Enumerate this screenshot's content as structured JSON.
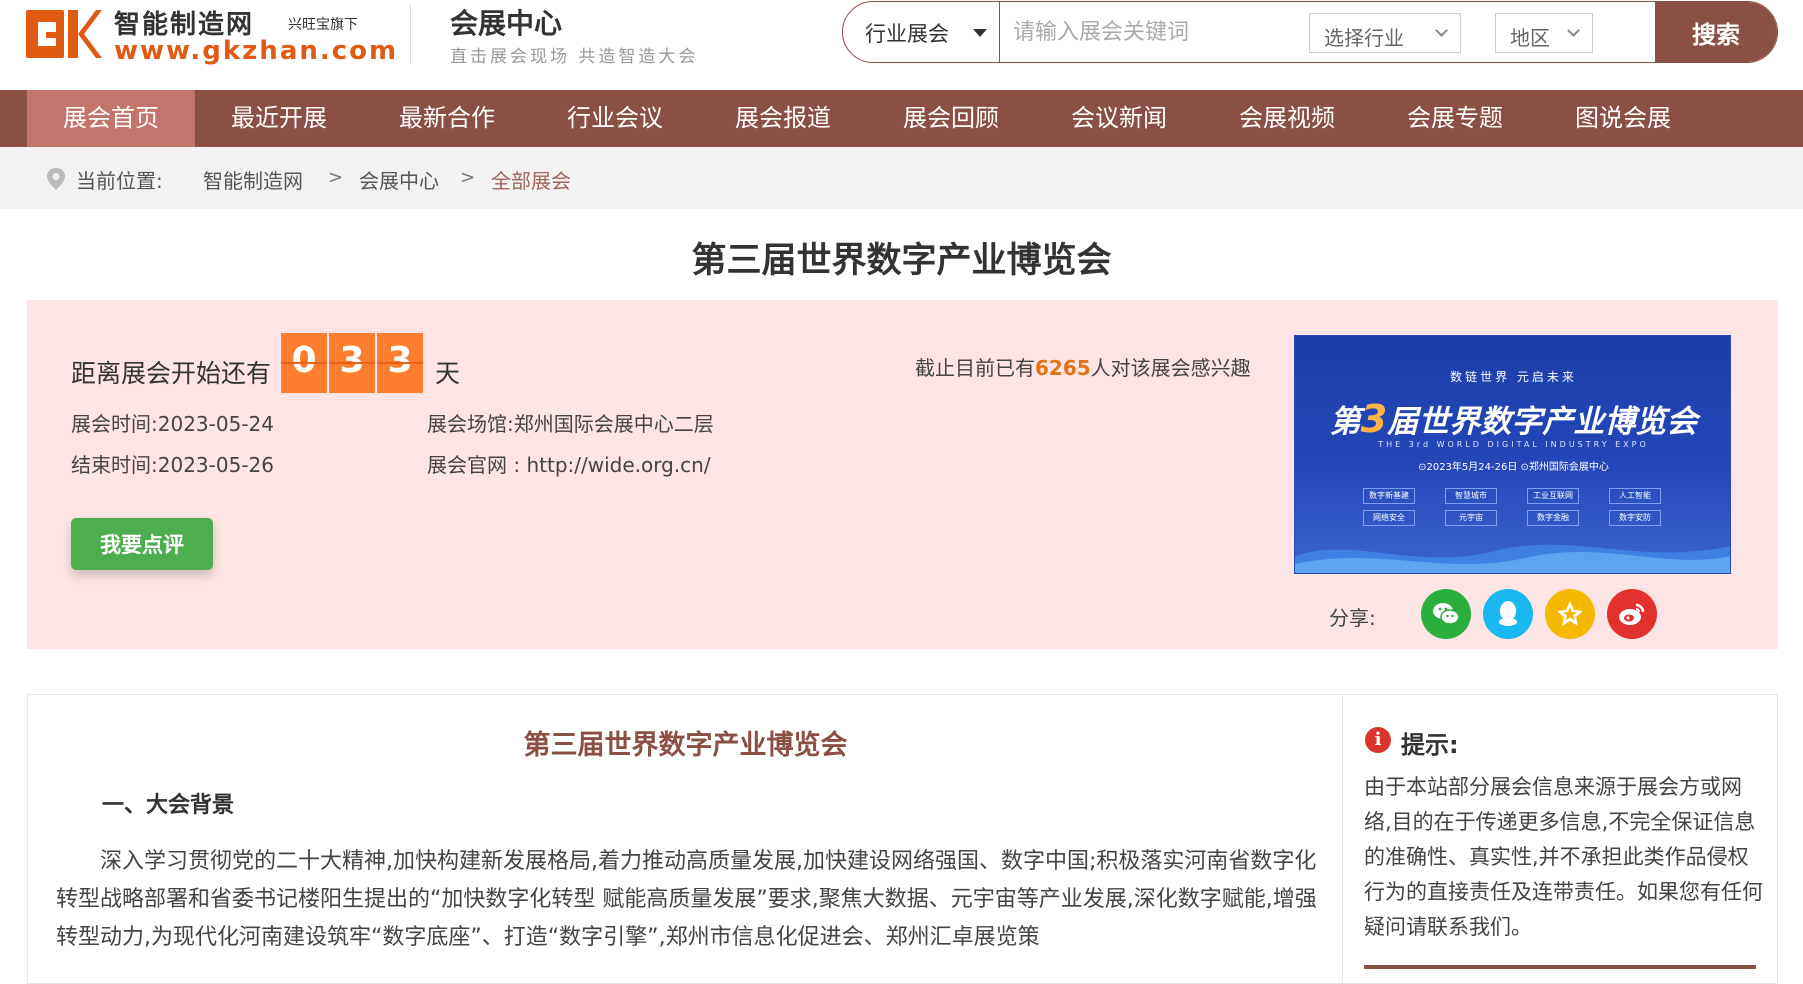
{
  "header": {
    "logo_title": "智能制造网",
    "logo_tag": "兴旺宝旗下",
    "logo_url": "www.gkzhan.com",
    "site_title": "会展中心",
    "site_slogan": "直击展会现场 共造智造大会",
    "brand_color": "#e05a12",
    "accent_color": "#8c4f45"
  },
  "search": {
    "type_label": "行业展会",
    "placeholder": "请输入展会关键词",
    "industry_select": "选择行业",
    "region_select": "地区",
    "button": "搜索"
  },
  "nav": {
    "items": [
      "展会首页",
      "最近开展",
      "最新合作",
      "行业会议",
      "展会报道",
      "展会回顾",
      "会议新闻",
      "会展视频",
      "会展专题",
      "图说会展"
    ],
    "active_index": 0
  },
  "breadcrumb": {
    "label": "当前位置:",
    "items": [
      "智能制造网",
      "会展中心",
      "全部展会"
    ],
    "separator": ">"
  },
  "event": {
    "title": "第三届世界数字产业博览会",
    "countdown_prefix": "距离展会开始还有",
    "countdown_digits": [
      "0",
      "3",
      "3"
    ],
    "countdown_suffix": "天",
    "interest_prefix": "截止目前已有",
    "interest_count": "6265",
    "interest_suffix": "人对该展会感兴趣",
    "start_label": "展会时间:",
    "start_date": "2023-05-24",
    "end_label": "结束时间:",
    "end_date": "2023-05-26",
    "venue_label": "展会场馆:",
    "venue": "郑州国际会展中心二层",
    "site_label": "展会官网 : ",
    "site": "http://wide.org.cn/",
    "review_button": "我要点评",
    "share_label": "分享:",
    "share_icons": [
      "wechat-icon",
      "qq-icon",
      "qzone-icon",
      "weibo-icon"
    ]
  },
  "banner": {
    "top_line": "数链世界 元启未来",
    "title_pre": "第",
    "title_num": "3",
    "title_post": "届世界数字产业博览会",
    "subtitle_en": "THE 3rd WORLD DIGITAL INDUSTRY EXPO",
    "date_line": "⊙2023年5月24-26日  ⊙郑州国际会展中心",
    "tags": [
      "数字新基建",
      "智慧城市",
      "工业互联网",
      "人工智能",
      "网络安全",
      "元宇宙",
      "数字金融",
      "数字安防"
    ]
  },
  "article": {
    "title": "第三届世界数字产业博览会",
    "section_heading": "一、大会背景",
    "paragraph": "深入学习贯彻党的二十大精神,加快构建新发展格局,着力推动高质量发展,加快建设网络强国、数字中国;积极落实河南省数字化转型战略部署和省委书记楼阳生提出的“加快数字化转型 赋能高质量发展”要求,聚焦大数据、元宇宙等产业发展,深化数字赋能,增强转型动力,为现代化河南建设筑牢“数字底座”、打造“数字引擎”,郑州市信息化促进会、郑州汇卓展览策"
  },
  "tips": {
    "title": "提示:",
    "body": "由于本站部分展会信息来源于展会方或网络,目的在于传递更多信息,不完全保证信息的准确性、真实性,并不承担此类作品侵权行为的直接责任及连带责任。如果您有任何疑问请联系我们。"
  }
}
